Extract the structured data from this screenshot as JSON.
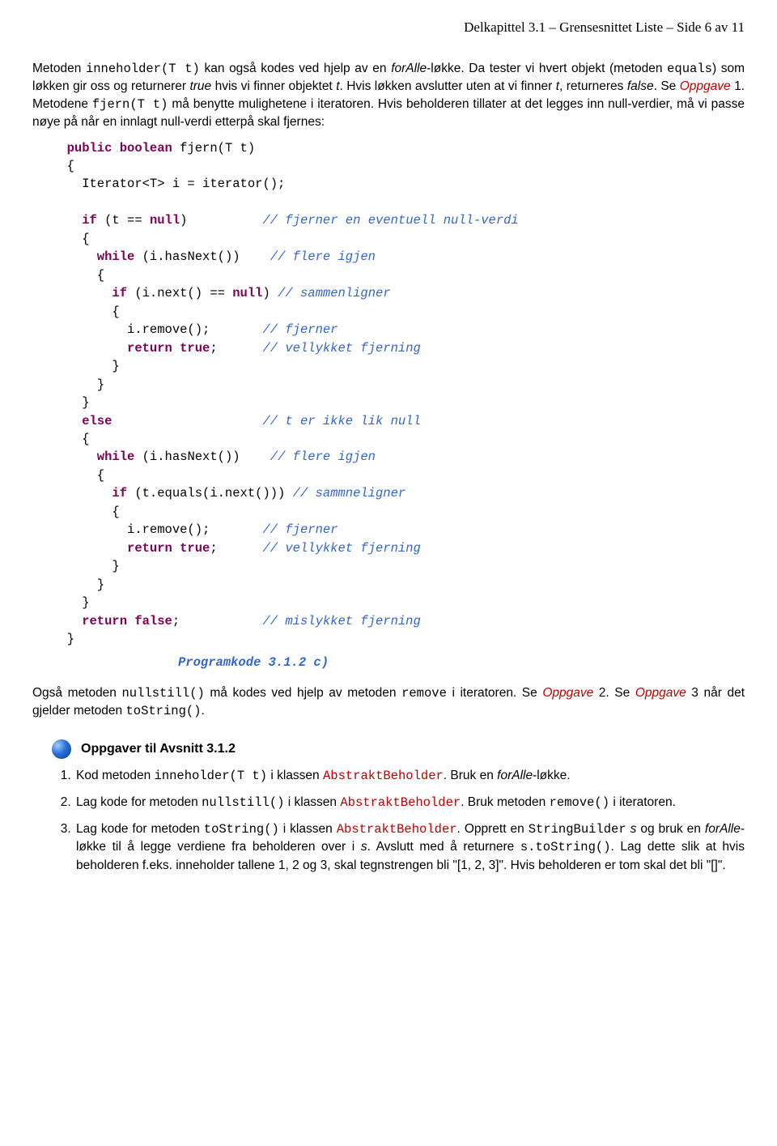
{
  "header": "Delkapittel 3.1 – Grensesnittet Liste – Side 6 av 11",
  "p1_a": "Metoden ",
  "p1_b": "inneholder(T t)",
  "p1_c": " kan også kodes ved hjelp av en ",
  "p1_d": "forAlle",
  "p1_e": "-løkke. Da tester vi hvert objekt (metoden ",
  "p1_f": "equals",
  "p1_g": ") som løkken gir oss og returnerer ",
  "p1_h": "true",
  "p1_i": " hvis vi finner objektet ",
  "p1_j": "t",
  "p1_k": ". Hvis løkken avslutter uten at vi finner ",
  "p1_l": "t",
  "p1_m": ", returneres ",
  "p1_n": "false",
  "p1_o": ". Se ",
  "p1_p": "Oppgave",
  "p1_q": " 1. Metodene ",
  "p1_r": "fjern(T t)",
  "p1_s": " må benytte mulighetene i iteratoren. Hvis beholderen tillater at det legges inn null-verdier, må vi passe nøye på når en innlagt null-verdi etterpå skal fjernes:",
  "code": {
    "l01a": "  public boolean",
    "l01b": " fjern(T t)",
    "l02": "  {",
    "l03": "    Iterator<T> i = iterator();",
    "l04": "",
    "l05a": "    if",
    "l05b": " (t == ",
    "l05c": "null",
    "l05d": ")          ",
    "l05e": "// fjerner en eventuell null-verdi",
    "l06": "    {",
    "l07a": "      while",
    "l07b": " (i.hasNext())    ",
    "l07c": "// flere igjen",
    "l08": "      {",
    "l09a": "        if",
    "l09b": " (i.next() == ",
    "l09c": "null",
    "l09d": ") ",
    "l09e": "// sammenligner",
    "l10": "        {",
    "l11a": "          i.remove();       ",
    "l11b": "// fjerner",
    "l12a": "          return true",
    "l12b": ";      ",
    "l12c": "// vellykket fjerning",
    "l13": "        }",
    "l14": "      }",
    "l15": "    }",
    "l16a": "    else",
    "l16b": "                    ",
    "l16c": "// t er ikke lik null",
    "l17": "    {",
    "l18a": "      while",
    "l18b": " (i.hasNext())    ",
    "l18c": "// flere igjen",
    "l19": "      {",
    "l20a": "        if",
    "l20b": " (t.equals(i.next())) ",
    "l20c": "// sammneligner",
    "l21": "        {",
    "l22a": "          i.remove();       ",
    "l22b": "// fjerner",
    "l23a": "          return true",
    "l23b": ";      ",
    "l23c": "// vellykket fjerning",
    "l24": "        }",
    "l25": "      }",
    "l26": "    }",
    "l27a": "    return false",
    "l27b": ";           ",
    "l27c": "// mislykket fjerning",
    "l28": "  }"
  },
  "caption": "Programkode 3.1.2 c)",
  "p2_a": "Også metoden ",
  "p2_b": "nullstill()",
  "p2_c": " må kodes ved hjelp av metoden ",
  "p2_d": "remove",
  "p2_e": " i iteratoren. Se ",
  "p2_f": "Oppgave",
  "p2_g": " 2. Se ",
  "p2_h": "Oppgave",
  "p2_i": " 3 når det gjelder metoden ",
  "p2_j": "toString()",
  "p2_k": ".",
  "section": "Oppgaver til Avsnitt 3.1.2",
  "task1_a": "Kod metoden ",
  "task1_b": "inneholder(T t)",
  "task1_c": " i klassen ",
  "task1_d": "AbstraktBeholder",
  "task1_e": ". Bruk en ",
  "task1_f": "forAlle",
  "task1_g": "-løkke.",
  "task2_a": "Lag kode for metoden ",
  "task2_b": "nullstill()",
  "task2_c": " i klassen ",
  "task2_d": "AbstraktBeholder",
  "task2_e": ". Bruk metoden ",
  "task2_f": "remove()",
  "task2_g": " i iteratoren.",
  "task3_a": "Lag kode for metoden ",
  "task3_b": "toString()",
  "task3_c": " i klassen ",
  "task3_d": "AbstraktBeholder",
  "task3_e": ". Opprett en ",
  "task3_f": "StringBuilder",
  "task3_g": " ",
  "task3_h": "s",
  "task3_i": " og bruk en ",
  "task3_j": "forAlle",
  "task3_k": "-løkke til å legge verdiene fra beholderen over i ",
  "task3_l": "s",
  "task3_m": ". Avslutt med å returnere ",
  "task3_n": "s.toString()",
  "task3_o": ". Lag dette slik at hvis beholderen f.eks. inneholder tallene 1, 2 og 3, skal tegnstrengen bli \"[1, 2, 3]\". Hvis beholderen er tom skal det bli \"[]\"."
}
